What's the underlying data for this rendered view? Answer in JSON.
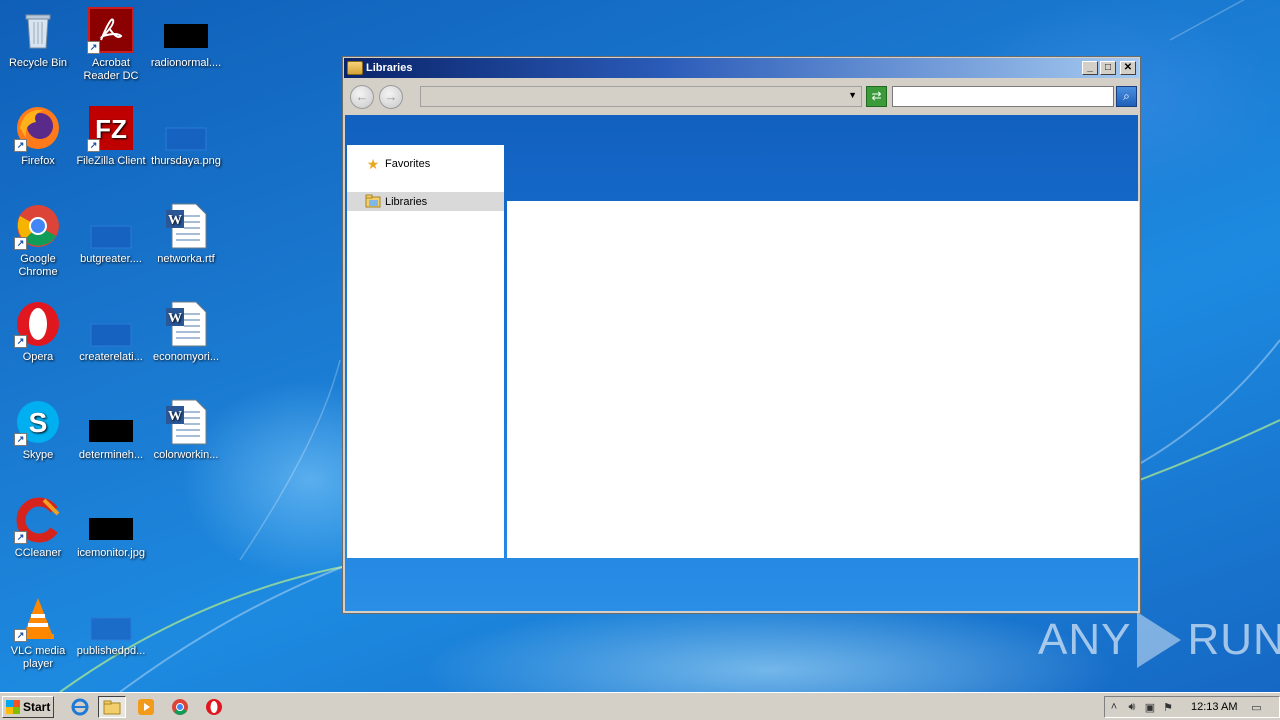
{
  "desktop": {
    "icons": [
      {
        "label": "Recycle Bin",
        "icon": "recycle-bin-icon"
      },
      {
        "label": "Acrobat Reader DC",
        "icon": "acrobat-icon"
      },
      {
        "label": "radionormal....",
        "icon": "black-thumbnail-icon"
      },
      {
        "label": "Firefox",
        "icon": "firefox-icon"
      },
      {
        "label": "FileZilla Client",
        "icon": "filezilla-icon"
      },
      {
        "label": "thursdaya.png",
        "icon": "png-file-icon"
      },
      {
        "label": "Google Chrome",
        "icon": "chrome-icon"
      },
      {
        "label": "butgreater....",
        "icon": "blank-file-icon"
      },
      {
        "label": "networka.rtf",
        "icon": "word-doc-icon"
      },
      {
        "label": "Opera",
        "icon": "opera-icon"
      },
      {
        "label": "createrelati...",
        "icon": "blank-file-icon"
      },
      {
        "label": "economyori...",
        "icon": "word-doc-icon"
      },
      {
        "label": "Skype",
        "icon": "skype-icon"
      },
      {
        "label": "determineh...",
        "icon": "black-thumbnail-icon"
      },
      {
        "label": "colorworkin...",
        "icon": "word-doc-icon"
      },
      {
        "label": "CCleaner",
        "icon": "ccleaner-icon"
      },
      {
        "label": "icemonitor.jpg",
        "icon": "black-thumbnail-icon"
      },
      {
        "label": "VLC media player",
        "icon": "vlc-icon"
      },
      {
        "label": "publishedpd...",
        "icon": "blank-file-icon"
      }
    ]
  },
  "window": {
    "title": "Libraries",
    "address_value": "",
    "search_value": "",
    "nav": {
      "favorites": "Favorites",
      "libraries": "Libraries"
    },
    "buttons": {
      "minimize": "_",
      "maximize": "□",
      "close": "✕"
    }
  },
  "taskbar": {
    "start_label": "Start",
    "clock": "12:13 AM",
    "apps": [
      "internet-explorer",
      "windows-explorer",
      "media-player",
      "chrome",
      "opera"
    ]
  },
  "watermark": {
    "left": "ANY",
    "right": "RUN"
  }
}
